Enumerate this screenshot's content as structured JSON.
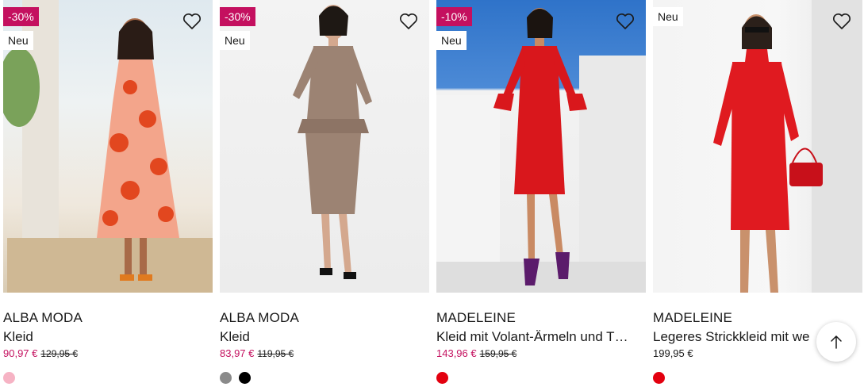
{
  "products": [
    {
      "brand": "ALBA MODA",
      "title": "Kleid",
      "price": "90,97 €",
      "old_price": "129,95 €",
      "on_sale": true,
      "discount": "-30%",
      "new_label": "Neu",
      "swatches": [
        "#f6b3c4"
      ]
    },
    {
      "brand": "ALBA MODA",
      "title": "Kleid",
      "price": "83,97 €",
      "old_price": "119,95 €",
      "on_sale": true,
      "discount": "-30%",
      "new_label": "Neu",
      "swatches": [
        "#8a8a8a",
        "#000000"
      ]
    },
    {
      "brand": "MADELEINE",
      "title": "Kleid mit Volant-Ärmeln und T…",
      "price": "143,96 €",
      "old_price": "159,95 €",
      "on_sale": true,
      "discount": "-10%",
      "new_label": "Neu",
      "swatches": [
        "#e3000f"
      ]
    },
    {
      "brand": "MADELEINE",
      "title": "Legeres Strickkleid mit we",
      "price": "199,95 €",
      "old_price": "",
      "on_sale": false,
      "discount": "",
      "new_label": "Neu",
      "swatches": [
        "#e3000f"
      ]
    }
  ],
  "icons": {
    "wishlist": "heart-outline-icon",
    "scroll_top": "arrow-up-icon"
  },
  "colors": {
    "sale": "#c4105f",
    "text": "#1a1a1a"
  }
}
